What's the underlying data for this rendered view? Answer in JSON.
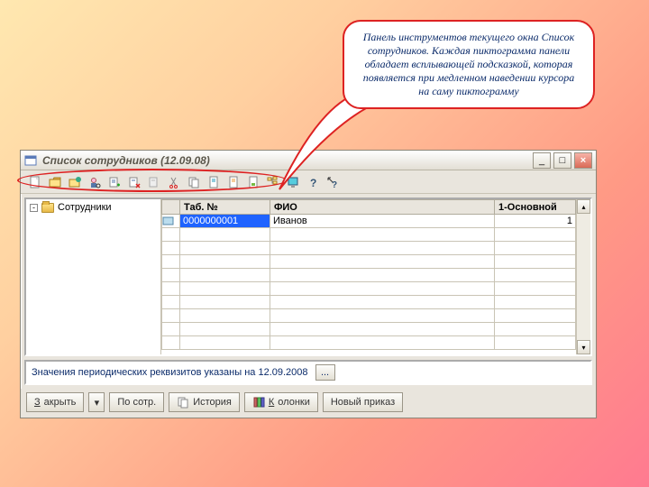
{
  "callout": {
    "text": "Панель инструментов текущего окна Список сотрудников. Каждая пиктограмма панели обладает всплывающей подсказкой, которая появляется при медленном наведении курсора на саму пиктограмму"
  },
  "window": {
    "title": "Список сотрудников (12.09.08)",
    "minimize": "_",
    "maximize": "□",
    "close": "×"
  },
  "toolbar": {
    "icons": [
      "new-doc-icon",
      "open-folder-icon",
      "folder-new-icon",
      "person-search-icon",
      "form-add-icon",
      "form-delete-icon",
      "form-edit-icon",
      "cut-icon",
      "copy-icon",
      "doc1-icon",
      "doc2-icon",
      "doc3-icon",
      "tree-icon",
      "monitor-icon",
      "help-icon",
      "help2-icon"
    ]
  },
  "tree": {
    "root": "Сотрудники"
  },
  "grid": {
    "columns": [
      "",
      "Таб. №",
      "ФИО",
      "1-Основной"
    ],
    "rows": [
      {
        "tab_no": "0000000001",
        "fio": "Иванов",
        "main": "1"
      }
    ],
    "empty_rows": 9
  },
  "status": {
    "text": "Значения периодических реквизитов указаны на 12.09.2008",
    "dots": "..."
  },
  "buttons": {
    "close_u": "З",
    "close_rest": "акрыть",
    "sort": "По сотр.",
    "history": "История",
    "columns_u": "К",
    "columns_rest": "олонки",
    "new_order": "Новый приказ",
    "caret": "▾"
  }
}
